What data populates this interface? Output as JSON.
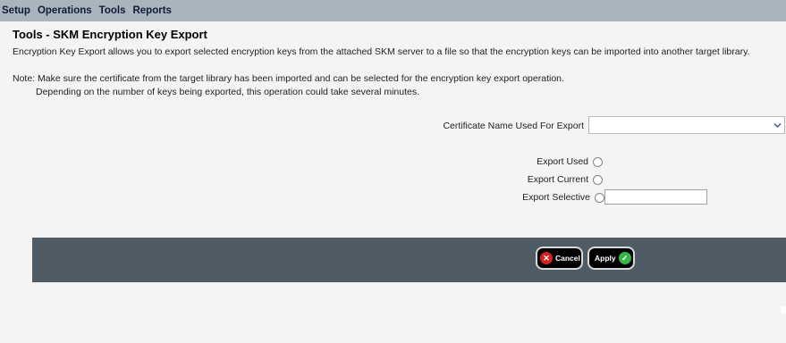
{
  "menu": {
    "items": [
      "Setup",
      "Operations",
      "Tools",
      "Reports"
    ]
  },
  "page": {
    "title": "Tools - SKM Encryption Key Export",
    "description": "Encryption Key Export allows you to export selected encryption keys from the attached SKM server to a file so that the encryption keys can be imported into another target library.",
    "note_line1": "Note: Make sure the certificate from the target library has been imported and can be selected for the encryption key export operation.",
    "note_line2": "Depending on the number of keys being exported, this operation could take several minutes."
  },
  "form": {
    "certificate_label": "Certificate Name Used For Export",
    "certificate_value": "",
    "options": [
      {
        "label": "Export Used",
        "selected": false
      },
      {
        "label": "Export Current",
        "selected": false
      },
      {
        "label": "Export Selective",
        "selected": false
      }
    ],
    "selective_value": ""
  },
  "actions": {
    "cancel_label": "Cancel",
    "apply_label": "Apply"
  },
  "icons": {
    "cancel": "x-circle-icon",
    "apply": "check-circle-icon",
    "dropdown": "chevron-down-icon"
  },
  "colors": {
    "menubar": "#a9b4bd",
    "action_bar": "#4f5c66",
    "cancel_icon": "#d61f1f",
    "apply_icon": "#35b44a"
  }
}
